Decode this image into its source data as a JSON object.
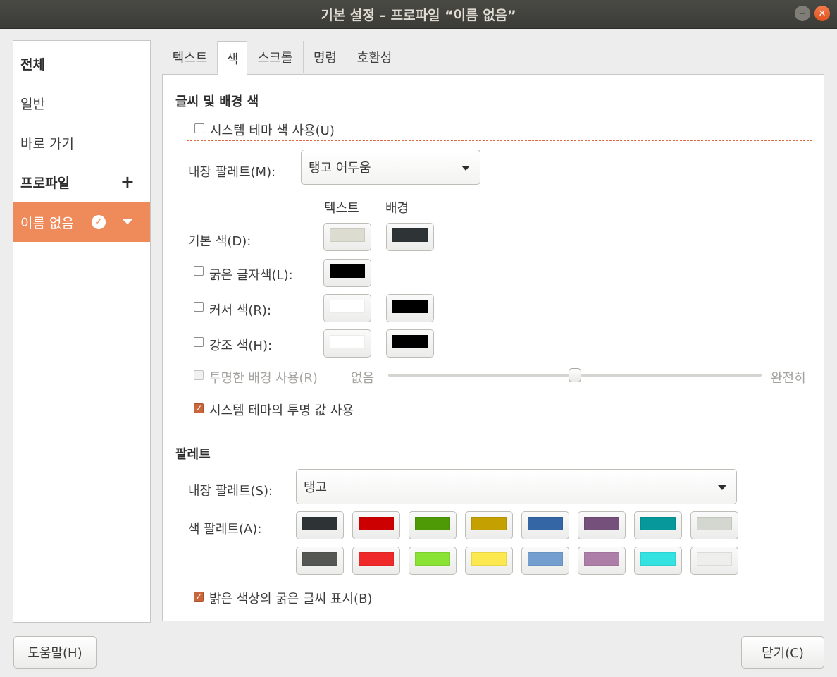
{
  "window": {
    "title": "기본 설정 – 프로파일 “이름 없음”",
    "minimize_icon": "−",
    "close_icon": "✕"
  },
  "sidebar": {
    "items": [
      {
        "label": "전체"
      },
      {
        "label": "일반"
      },
      {
        "label": "바로 가기"
      },
      {
        "label": "프로파일",
        "add": "+"
      },
      {
        "label": "이름 없음",
        "check": "✓"
      }
    ]
  },
  "tabs": [
    {
      "label": "텍스트"
    },
    {
      "label": "색"
    },
    {
      "label": "스크롤"
    },
    {
      "label": "명령"
    },
    {
      "label": "호환성"
    }
  ],
  "colors_section": {
    "heading": "글씨 및 배경 색",
    "use_system_theme": "시스템 테마 색 사용(U)",
    "builtin_scheme_label": "내장 팔레트(M):",
    "builtin_scheme_value": "탱고 어두움",
    "col_text": "텍스트",
    "col_bg": "배경",
    "default_color": "기본 색(D):",
    "bold_color": "굵은 글자색(L):",
    "cursor_color": "커서 색(R):",
    "highlight_color": "강조 색(H):",
    "transparent_bg": "투명한 배경 사용(R)",
    "slider_none": "없음",
    "slider_full": "완전히",
    "slider_value": 0.5,
    "use_theme_transparency": "시스템 테마의 투명 값 사용",
    "swatches": {
      "default_text": "#dcdcd0",
      "default_bg": "#2e3436",
      "bold": "#000000",
      "cursor_text": "#ffffff",
      "cursor_bg": "#000000",
      "highlight_text": "#ffffff",
      "highlight_bg": "#000000"
    }
  },
  "palette_section": {
    "heading": "팔레트",
    "builtin_label": "내장 팔레트(S):",
    "builtin_value": "탱고",
    "color_palette_label": "색 팔레트(A):",
    "palette_colors": [
      "#2e3436",
      "#cc0000",
      "#4e9a06",
      "#c4a000",
      "#3465a4",
      "#75507b",
      "#06989a",
      "#d3d7cf",
      "#555753",
      "#ef2929",
      "#8ae234",
      "#fce94f",
      "#729fcf",
      "#ad7fa8",
      "#34e2e2",
      "#eeeeec"
    ],
    "bright_bold": "밝은 색상의 굵은 글씨 표시(B)"
  },
  "buttons": {
    "help": "도움말(H)",
    "close": "닫기(C)"
  },
  "accent": "#ef8b5b"
}
